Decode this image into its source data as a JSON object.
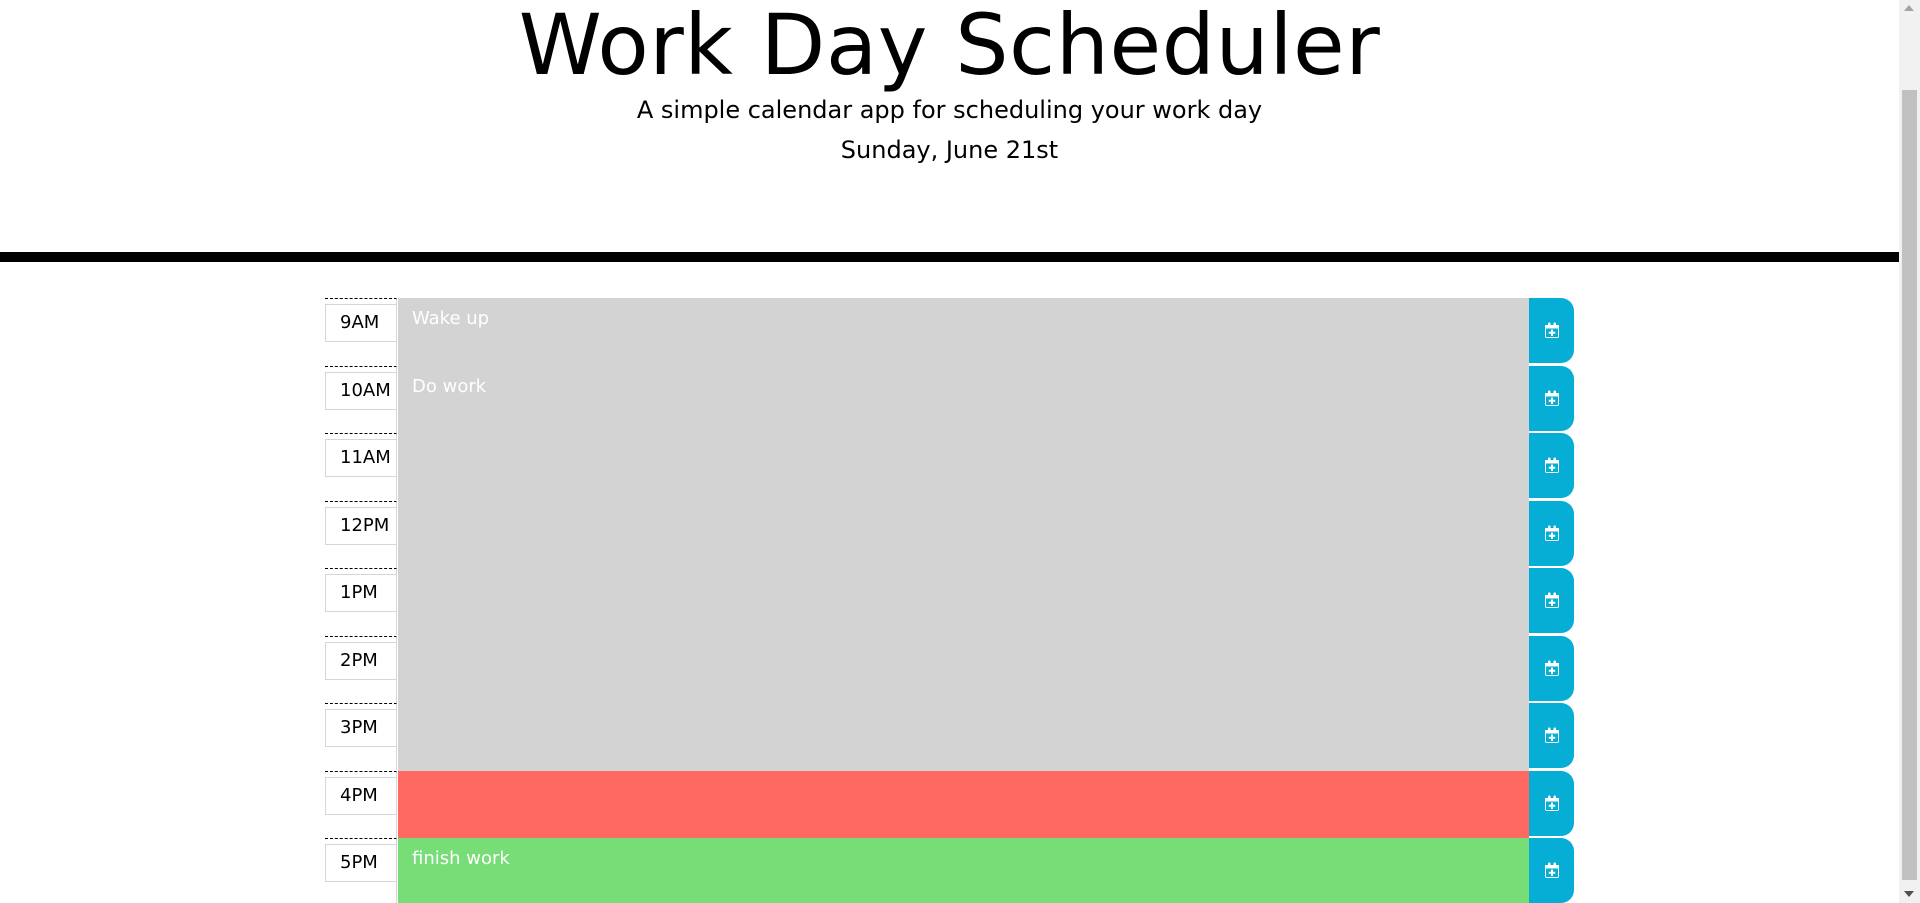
{
  "header": {
    "title": "Work Day Scheduler",
    "lead": "A simple calendar app for scheduling your work day",
    "current_day": "Sunday, June 21st"
  },
  "time_blocks": [
    {
      "hour": "9AM",
      "text": "Wake up",
      "status": "past"
    },
    {
      "hour": "10AM",
      "text": "Do work",
      "status": "past"
    },
    {
      "hour": "11AM",
      "text": "",
      "status": "past"
    },
    {
      "hour": "12PM",
      "text": "",
      "status": "past"
    },
    {
      "hour": "1PM",
      "text": "",
      "status": "past"
    },
    {
      "hour": "2PM",
      "text": "",
      "status": "past"
    },
    {
      "hour": "3PM",
      "text": "",
      "status": "past"
    },
    {
      "hour": "4PM",
      "text": "",
      "status": "present"
    },
    {
      "hour": "5PM",
      "text": "finish work",
      "status": "future"
    }
  ],
  "save_icon": "calendar-plus-icon",
  "colors": {
    "past": "#d3d3d3",
    "present": "#ff6961",
    "future": "#77dd77",
    "save_button": "#06aed5",
    "text_on_block": "#ffffff"
  }
}
